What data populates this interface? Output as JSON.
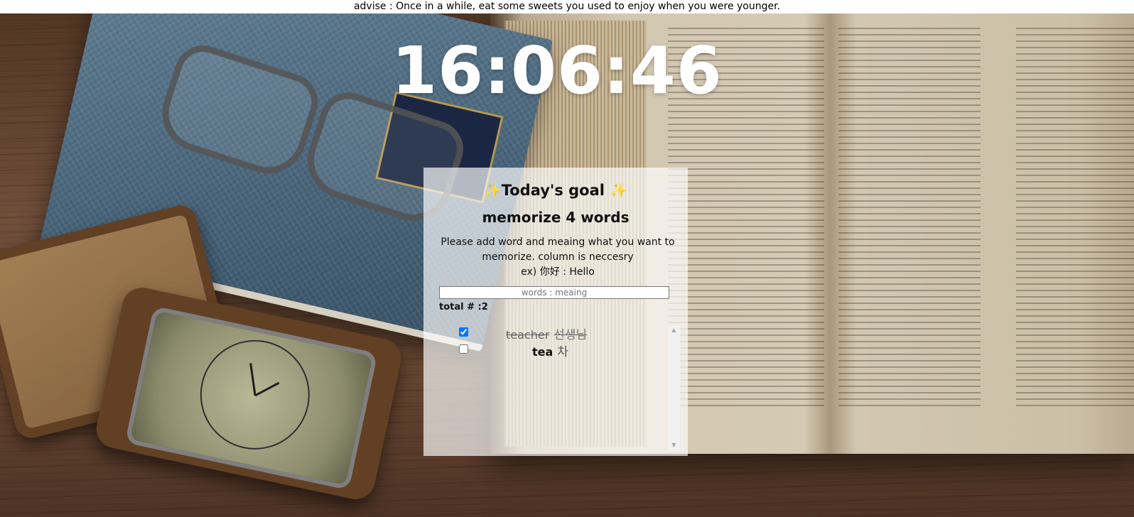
{
  "advice": {
    "text": "advise : Once in a while, eat some sweets you used to enjoy when you were younger."
  },
  "clock": {
    "time": "16:06:46"
  },
  "goal": {
    "sparkle_left": "✨",
    "title": "Today's goal",
    "sparkle_right": "✨",
    "subtitle": "memorize 4 words",
    "instruction_line1": "Please add word and meaing what you want to",
    "instruction_line2": "memorize. column is neccesry",
    "example": "ex) 你好 : Hello",
    "input_placeholder": "words : meaing",
    "total_label": "total # :2",
    "words": [
      {
        "word": "teacher",
        "meaning": "선생님",
        "checked": true
      },
      {
        "word": "tea",
        "meaning": "차",
        "checked": false
      }
    ]
  },
  "scrollbar": {
    "up_arrow": "▲",
    "down_arrow": "▼"
  }
}
